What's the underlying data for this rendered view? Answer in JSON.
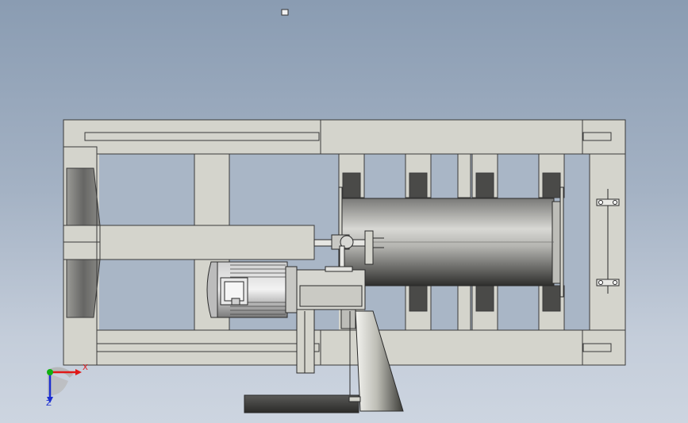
{
  "viewport": {
    "background_top": "#8a9cb2",
    "background_bottom": "#cdd5e0"
  },
  "triad": {
    "x_label": "X",
    "z_label": "Z",
    "x_color": "#e01818",
    "y_color": "#10b010",
    "z_color": "#1c2ed0"
  },
  "model": {
    "frame_color": "#d4d4cc",
    "edge_color": "#3a3a3a",
    "drum_color": "#9a9a96"
  }
}
